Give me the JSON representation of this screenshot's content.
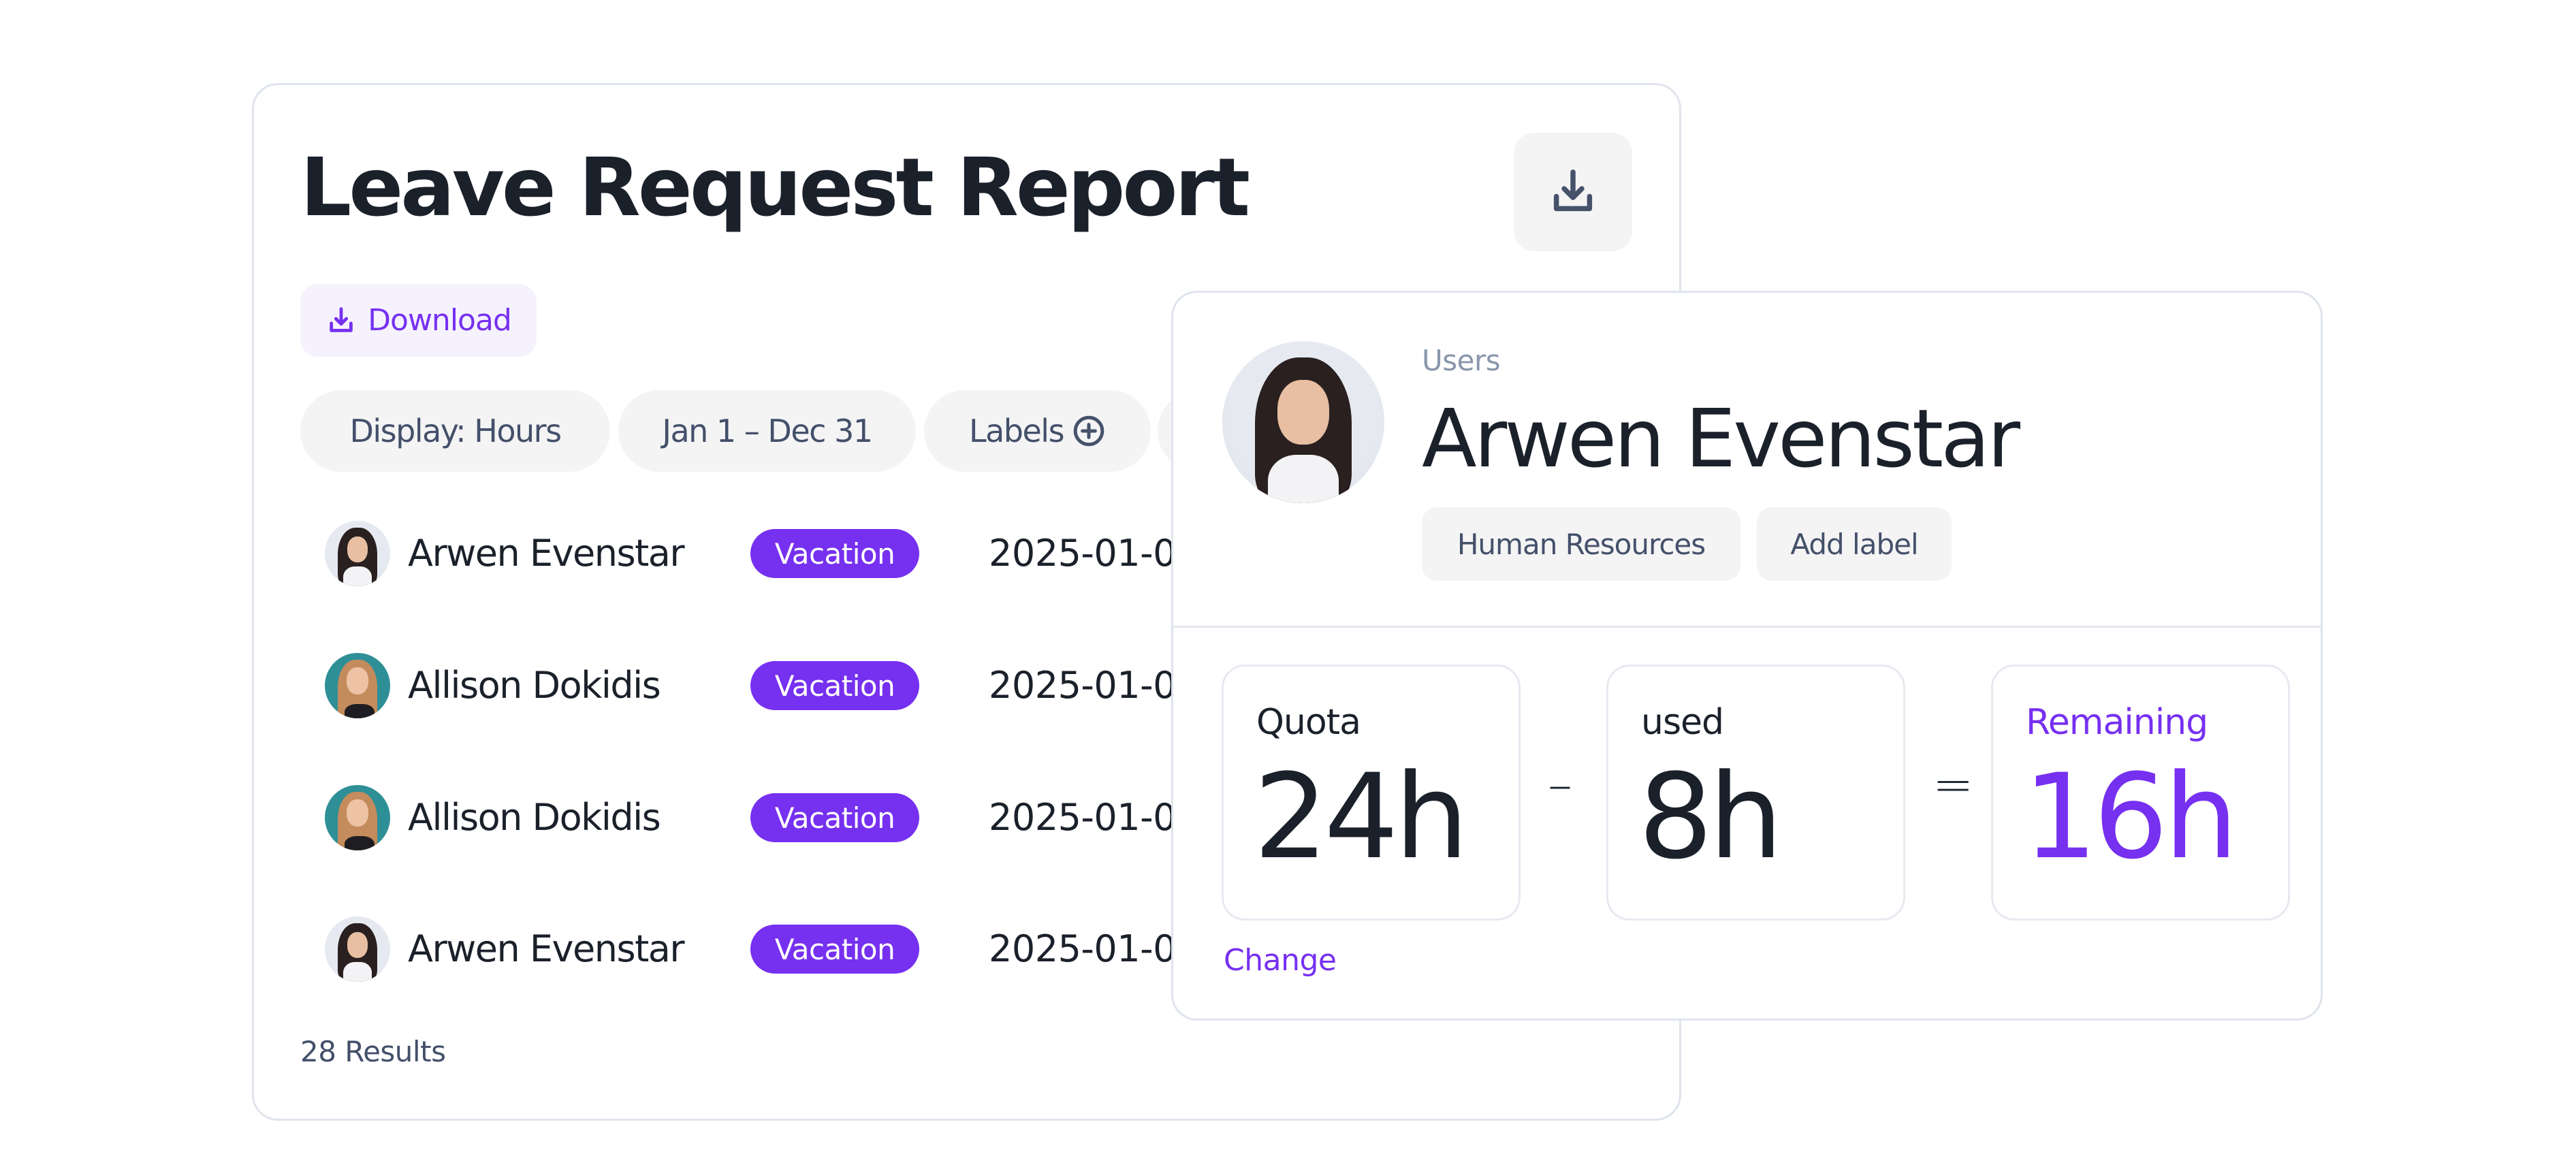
{
  "report": {
    "title": "Leave Request Report",
    "icon_button": "download-icon",
    "download_label": "Download",
    "filters": [
      {
        "label": "Display: Hours"
      },
      {
        "label": "Jan 1 – Dec 31"
      },
      {
        "label": "Labels",
        "icon": "plus-circle-icon"
      },
      {
        "label": ""
      }
    ],
    "rows": [
      {
        "name": "Arwen Evenstar",
        "type": "Vacation",
        "date": "2025-01-0"
      },
      {
        "name": "Allison Dokidis",
        "type": "Vacation",
        "date": "2025-01-0"
      },
      {
        "name": "Allison Dokidis",
        "type": "Vacation",
        "date": "2025-01-0"
      },
      {
        "name": "Arwen Evenstar",
        "type": "Vacation",
        "date": "2025-01-0"
      }
    ],
    "results": "28 Results"
  },
  "user_card": {
    "breadcrumb": "Users",
    "name": "Arwen Evenstar",
    "labels": [
      "Human Resources",
      "Add label"
    ],
    "quota": {
      "label": "Quota",
      "value": "24h"
    },
    "used": {
      "label": "used",
      "value": "8h"
    },
    "remaining": {
      "label": "Remaining",
      "value": "16h"
    },
    "minus_sign": "–",
    "equals_sign": "=",
    "change_link": "Change"
  },
  "colors": {
    "accent": "#7630f0",
    "text": "#1b212b",
    "muted": "#44506a",
    "chip_bg": "#f4f4f5",
    "border": "#dfe4ec"
  }
}
